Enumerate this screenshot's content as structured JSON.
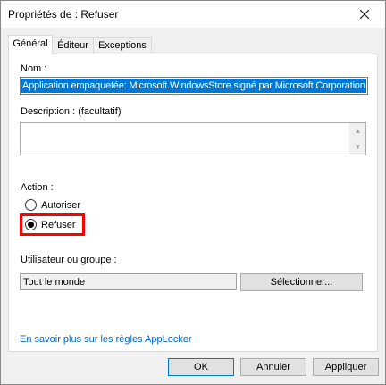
{
  "window": {
    "title": "Propriétés de : Refuser",
    "close_icon": "close-icon"
  },
  "tabs": [
    {
      "label": "Général",
      "active": true
    },
    {
      "label": "Éditeur",
      "active": false
    },
    {
      "label": "Exceptions",
      "active": false
    }
  ],
  "form": {
    "name_label": "Nom :",
    "name_value": "Application empaquetée: Microsoft.WindowsStore signé par Microsoft Corporation",
    "description_label": "Description : (facultatif)",
    "description_value": "",
    "action_label": "Action :",
    "action_options": [
      {
        "label": "Autoriser",
        "checked": false
      },
      {
        "label": "Refuser",
        "checked": true
      }
    ],
    "user_group_label": "Utilisateur ou groupe :",
    "user_group_value": "Tout le monde",
    "select_button": "Sélectionner...",
    "help_link": "En savoir plus sur les règles AppLocker"
  },
  "footer": {
    "ok": "OK",
    "cancel": "Annuler",
    "apply": "Appliquer"
  },
  "colors": {
    "selection": "#0078d7",
    "highlight_box": "#ff0000",
    "link": "#0066cc"
  }
}
